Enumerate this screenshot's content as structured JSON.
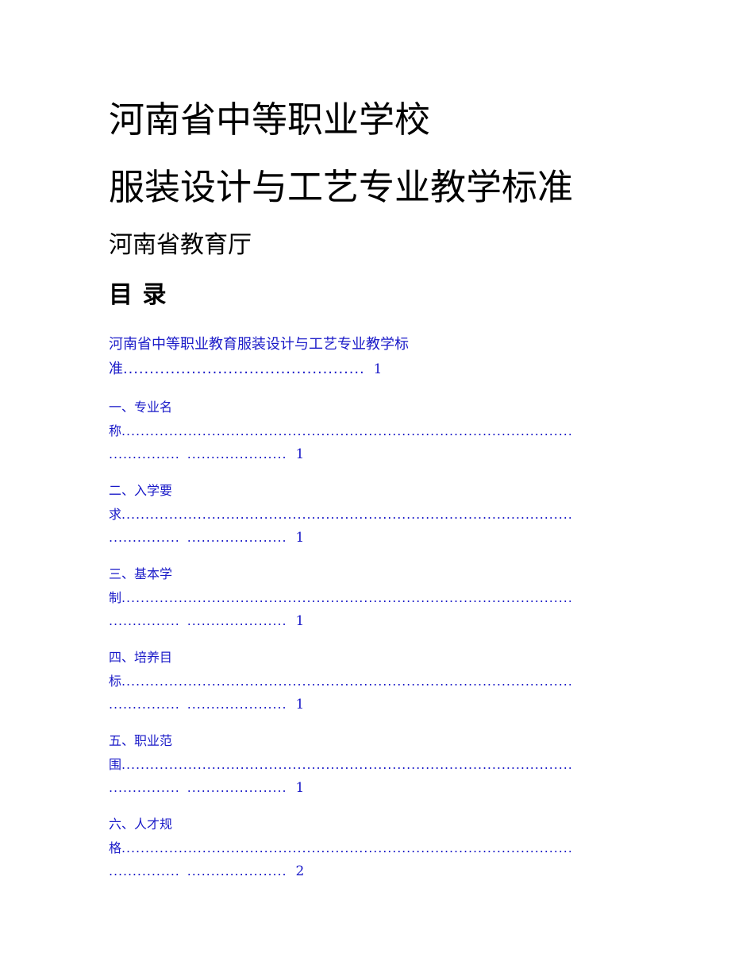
{
  "document": {
    "title_line_1": "河南省中等职业学校",
    "title_line_2": "服装设计与工艺专业教学标准",
    "publisher": "河南省教育厅",
    "toc_heading": "目 录",
    "text_color": "#000000",
    "toc_color": "#1a1ac8",
    "background": "#ffffff"
  },
  "toc": {
    "entries": [
      {
        "full_label": "河南省中等职业教育服装设计与工艺专业教学标准",
        "line_1_text": "河南省中等职业教育服装设计与工艺专业教学标",
        "line_2_text": "准",
        "line_2_dots": "..............................................",
        "line_3_dots_a": "",
        "line_3_dots_b": "",
        "page": "1"
      },
      {
        "full_label": "一、专业名称",
        "line_1_text": "一、专业名",
        "line_2_text": "称",
        "line_2_dots": "...............................................................................................",
        "line_3_dots_a": "...............",
        "line_3_dots_b": ".....................",
        "page": "1"
      },
      {
        "full_label": "二、入学要求",
        "line_1_text": "二、入学要",
        "line_2_text": "求",
        "line_2_dots": "...............................................................................................",
        "line_3_dots_a": "...............",
        "line_3_dots_b": ".....................",
        "page": "1"
      },
      {
        "full_label": "三、基本学制",
        "line_1_text": "三、基本学",
        "line_2_text": "制",
        "line_2_dots": "...............................................................................................",
        "line_3_dots_a": "...............",
        "line_3_dots_b": ".....................",
        "page": "1"
      },
      {
        "full_label": "四、培养目标",
        "line_1_text": "四、培养目",
        "line_2_text": "标",
        "line_2_dots": "...............................................................................................",
        "line_3_dots_a": "...............",
        "line_3_dots_b": ".....................",
        "page": "1"
      },
      {
        "full_label": "五、职业范围",
        "line_1_text": "五、职业范",
        "line_2_text": "围",
        "line_2_dots": "...............................................................................................",
        "line_3_dots_a": "...............",
        "line_3_dots_b": ".....................",
        "page": "1"
      },
      {
        "full_label": "六、人才规格",
        "line_1_text": "六、人才规",
        "line_2_text": "格",
        "line_2_dots": "...............................................................................................",
        "line_3_dots_a": "...............",
        "line_3_dots_b": ".....................",
        "page": "2"
      }
    ]
  }
}
